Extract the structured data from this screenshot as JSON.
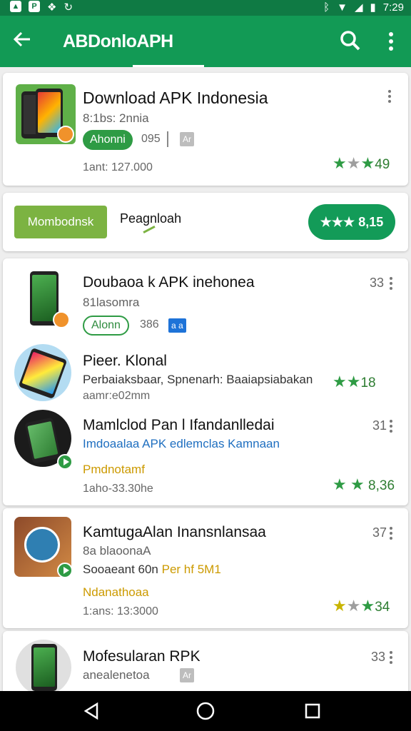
{
  "status_bar": {
    "time": "7:29"
  },
  "app_bar": {
    "title": "ABDonloAPH"
  },
  "featured": {
    "title": "Download APK Indonesia",
    "subtitle": "8:1bs: 2nnia",
    "pill_label": "Ahonni",
    "size": "095",
    "tag": "Ar",
    "installs": "1ant: 127.000",
    "rating": "49"
  },
  "filter": {
    "button_label": "Mombodnsk",
    "tab_label": "Peagnloah",
    "rating_label": "8,15"
  },
  "list": [
    {
      "title": "Doubaoa k APK inehonea",
      "subtitle": "81lasomra",
      "pill_label": "Alonn",
      "size": "386",
      "tag": "a a",
      "count": "33"
    },
    {
      "title": "Pieer. Klonal",
      "subtitle": "Perbaiaksbaar, Spnenarh: Baaiapsiabakan",
      "meta": "aamr:e02mm",
      "rating": "18"
    },
    {
      "title": "Mamlclod Pan l Ifandanlledai",
      "subtitle": "Imdoaalaa APK edlemclas Kamnaan",
      "category": "Pmdnotamf",
      "meta": "1aho-33.30he",
      "rating": "8,36",
      "count": "31"
    },
    {
      "title": "KamtugaAlan Inansnlansaa",
      "subtitle": "8a blaoonaA",
      "extra": "Sooaeant 60n",
      "extra_highlight": "Per hf 5M1",
      "category": "Ndanathoaa",
      "meta": "1:ans: 13:3000",
      "rating": "34",
      "count": "37"
    },
    {
      "title": "Mofesularan RPK",
      "subtitle": "anealenetoa",
      "tag": "Ar",
      "count": "33"
    }
  ]
}
